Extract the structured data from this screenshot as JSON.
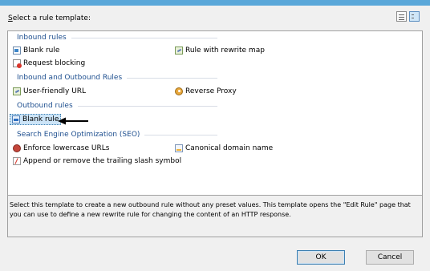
{
  "dialog": {
    "prompt_accel": "S",
    "prompt_rest": "elect a rule template:",
    "description": "Select this template to create a new outbound rule without any preset values. This template opens the \"Edit Rule\" page that you can use to define a new rewrite rule for changing the content of an HTTP response."
  },
  "groups": {
    "inbound": "Inbound rules",
    "inbound_outbound": "Inbound and Outbound Rules",
    "outbound": "Outbound rules",
    "seo": "Search Engine Optimization (SEO)"
  },
  "items": {
    "blank_rule_in": "Blank rule",
    "rewrite_map": "Rule with rewrite map",
    "request_blocking": "Request blocking",
    "user_friendly_url": "User-friendly URL",
    "reverse_proxy": "Reverse Proxy",
    "blank_rule_out": "Blank rule",
    "lowercase": "Enforce lowercase URLs",
    "canonical": "Canonical domain name",
    "trailing_slash": "Append or remove the trailing slash symbol"
  },
  "buttons": {
    "ok": "OK",
    "cancel": "Cancel"
  },
  "colors": {
    "group_header": "#1e4f8f",
    "selection": "#cce4f7",
    "titlebar": "#5aa7d9"
  }
}
